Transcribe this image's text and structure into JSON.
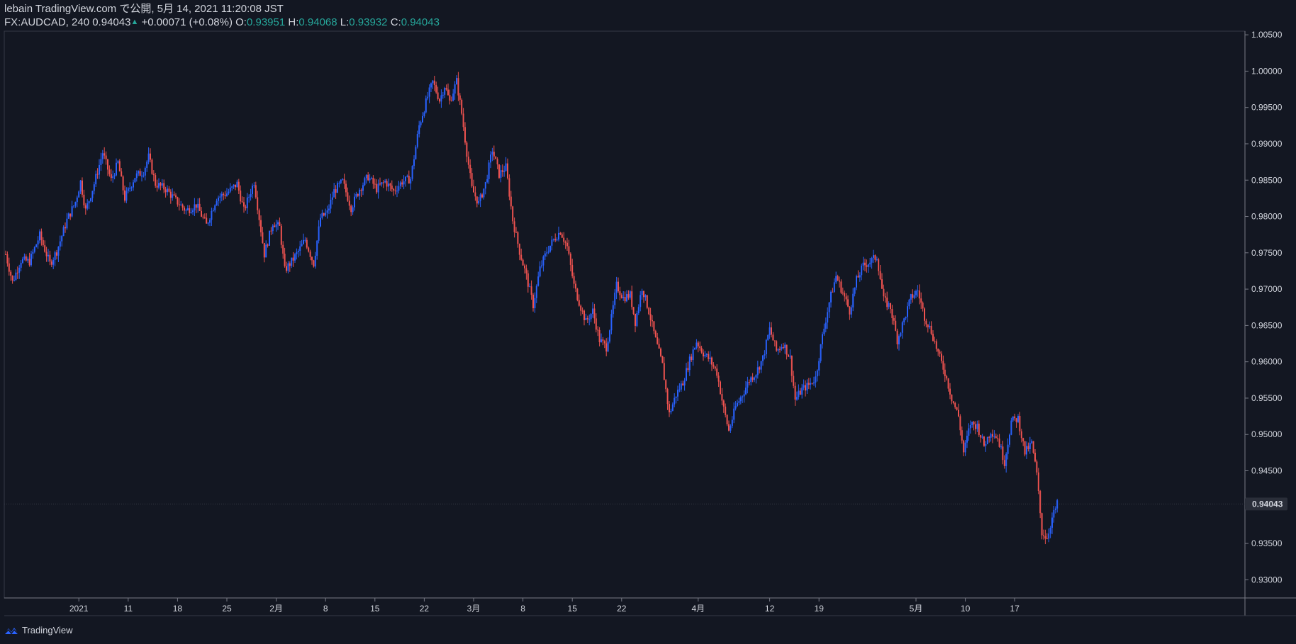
{
  "header": {
    "line1": "lebain TradingView.com で公開, 5月 14, 2021 11:20:08 JST",
    "symbol": "FX:AUDCAD, 240",
    "last": "0.94043",
    "change": "+0.00071 (+0.08%)",
    "o_label": "O:",
    "o_value": "0.93951",
    "h_label": "H:",
    "h_value": "0.94068",
    "l_label": "L:",
    "l_value": "0.93932",
    "c_label": "C:",
    "c_value": "0.94043"
  },
  "footer": {
    "brand": "TradingView"
  },
  "colors": {
    "background": "#131722",
    "up": "#2962ff",
    "down": "#ef5350",
    "teal": "#26a69a",
    "axis": "#787b86",
    "text": "#d1d4dc"
  },
  "chart_data": {
    "type": "candlestick",
    "symbol": "FX:AUDCAD",
    "timeframe": "240",
    "ylim": [
      0.9275,
      1.0055
    ],
    "y_ticks": [
      "1.00500",
      "1.00000",
      "0.99500",
      "0.99000",
      "0.98500",
      "0.98000",
      "0.97500",
      "0.97000",
      "0.96500",
      "0.96000",
      "0.95500",
      "0.95000",
      "0.94500",
      "0.94000",
      "0.93500",
      "0.93000"
    ],
    "y_tick_values": [
      1.005,
      1.0,
      0.995,
      0.99,
      0.985,
      0.98,
      0.975,
      0.97,
      0.965,
      0.96,
      0.955,
      0.95,
      0.945,
      0.94,
      0.935,
      0.93
    ],
    "x_ticks": [
      "2021",
      "11",
      "18",
      "25",
      "2月",
      "8",
      "15",
      "22",
      "3月",
      "8",
      "15",
      "22",
      "4月",
      "12",
      "19",
      "5月",
      "10",
      "17"
    ],
    "x_tick_index": [
      43,
      72,
      101,
      130,
      159,
      188,
      217,
      246,
      275,
      304,
      333,
      362,
      407,
      449,
      478,
      535,
      564,
      593
    ],
    "last_price": 0.94043,
    "last_label": "0.94043",
    "grid": false,
    "anchors": [
      [
        0,
        0.9748
      ],
      [
        4,
        0.971
      ],
      [
        9,
        0.974
      ],
      [
        14,
        0.9738
      ],
      [
        20,
        0.9774
      ],
      [
        26,
        0.9735
      ],
      [
        30,
        0.9752
      ],
      [
        36,
        0.9795
      ],
      [
        41,
        0.982
      ],
      [
        44,
        0.9848
      ],
      [
        47,
        0.9808
      ],
      [
        52,
        0.9845
      ],
      [
        57,
        0.9888
      ],
      [
        62,
        0.985
      ],
      [
        66,
        0.9874
      ],
      [
        70,
        0.9825
      ],
      [
        76,
        0.9855
      ],
      [
        81,
        0.9862
      ],
      [
        84,
        0.9882
      ],
      [
        88,
        0.9845
      ],
      [
        94,
        0.9838
      ],
      [
        100,
        0.9822
      ],
      [
        106,
        0.9808
      ],
      [
        112,
        0.9816
      ],
      [
        118,
        0.9788
      ],
      [
        124,
        0.9826
      ],
      [
        130,
        0.9832
      ],
      [
        136,
        0.9845
      ],
      [
        140,
        0.9808
      ],
      [
        146,
        0.9848
      ],
      [
        152,
        0.9748
      ],
      [
        157,
        0.9792
      ],
      [
        161,
        0.9785
      ],
      [
        164,
        0.9726
      ],
      [
        168,
        0.9738
      ],
      [
        172,
        0.9752
      ],
      [
        176,
        0.9768
      ],
      [
        181,
        0.9735
      ],
      [
        185,
        0.9798
      ],
      [
        189,
        0.9805
      ],
      [
        193,
        0.9835
      ],
      [
        198,
        0.9848
      ],
      [
        203,
        0.9812
      ],
      [
        208,
        0.9838
      ],
      [
        213,
        0.9855
      ],
      [
        218,
        0.9838
      ],
      [
        223,
        0.9848
      ],
      [
        228,
        0.9835
      ],
      [
        233,
        0.9848
      ],
      [
        238,
        0.9852
      ],
      [
        243,
        0.9925
      ],
      [
        248,
        0.9965
      ],
      [
        251,
        0.9985
      ],
      [
        255,
        0.996
      ],
      [
        258,
        0.998
      ],
      [
        261,
        0.9958
      ],
      [
        265,
        0.9986
      ],
      [
        268,
        0.9942
      ],
      [
        271,
        0.9888
      ],
      [
        274,
        0.9838
      ],
      [
        278,
        0.9818
      ],
      [
        282,
        0.9845
      ],
      [
        286,
        0.9892
      ],
      [
        290,
        0.9858
      ],
      [
        294,
        0.9868
      ],
      [
        298,
        0.9795
      ],
      [
        302,
        0.9752
      ],
      [
        306,
        0.9718
      ],
      [
        310,
        0.9678
      ],
      [
        314,
        0.9728
      ],
      [
        318,
        0.9752
      ],
      [
        322,
        0.9768
      ],
      [
        326,
        0.978
      ],
      [
        330,
        0.9758
      ],
      [
        334,
        0.9705
      ],
      [
        338,
        0.9675
      ],
      [
        341,
        0.9655
      ],
      [
        345,
        0.967
      ],
      [
        349,
        0.963
      ],
      [
        353,
        0.962
      ],
      [
        356,
        0.966
      ],
      [
        359,
        0.9705
      ],
      [
        363,
        0.9688
      ],
      [
        367,
        0.9692
      ],
      [
        370,
        0.9655
      ],
      [
        374,
        0.9702
      ],
      [
        378,
        0.967
      ],
      [
        382,
        0.963
      ],
      [
        386,
        0.9595
      ],
      [
        390,
        0.9528
      ],
      [
        394,
        0.9555
      ],
      [
        398,
        0.9572
      ],
      [
        402,
        0.9602
      ],
      [
        406,
        0.9628
      ],
      [
        410,
        0.9612
      ],
      [
        414,
        0.9602
      ],
      [
        418,
        0.9585
      ],
      [
        422,
        0.9535
      ],
      [
        425,
        0.9505
      ],
      [
        429,
        0.9538
      ],
      [
        433,
        0.9555
      ],
      [
        437,
        0.9575
      ],
      [
        441,
        0.9585
      ],
      [
        445,
        0.9605
      ],
      [
        449,
        0.9645
      ],
      [
        453,
        0.9615
      ],
      [
        457,
        0.9625
      ],
      [
        461,
        0.9605
      ],
      [
        464,
        0.9548
      ],
      [
        468,
        0.9562
      ],
      [
        472,
        0.9568
      ],
      [
        476,
        0.9578
      ],
      [
        480,
        0.9635
      ],
      [
        484,
        0.9682
      ],
      [
        488,
        0.9718
      ],
      [
        492,
        0.9695
      ],
      [
        496,
        0.967
      ],
      [
        500,
        0.9712
      ],
      [
        504,
        0.9732
      ],
      [
        508,
        0.9738
      ],
      [
        512,
        0.9745
      ],
      [
        516,
        0.9685
      ],
      [
        520,
        0.9675
      ],
      [
        524,
        0.963
      ],
      [
        528,
        0.9658
      ],
      [
        532,
        0.9688
      ],
      [
        536,
        0.9698
      ],
      [
        540,
        0.9662
      ],
      [
        544,
        0.9642
      ],
      [
        548,
        0.9612
      ],
      [
        552,
        0.9585
      ],
      [
        556,
        0.955
      ],
      [
        560,
        0.9525
      ],
      [
        563,
        0.9475
      ],
      [
        567,
        0.9515
      ],
      [
        571,
        0.9512
      ],
      [
        575,
        0.9485
      ],
      [
        579,
        0.9505
      ],
      [
        583,
        0.9495
      ],
      [
        587,
        0.9462
      ],
      [
        591,
        0.9518
      ],
      [
        595,
        0.9522
      ],
      [
        599,
        0.9475
      ],
      [
        603,
        0.9488
      ],
      [
        606,
        0.9445
      ],
      [
        609,
        0.9365
      ],
      [
        612,
        0.9358
      ],
      [
        615,
        0.9385
      ],
      [
        618,
        0.9404
      ]
    ]
  }
}
